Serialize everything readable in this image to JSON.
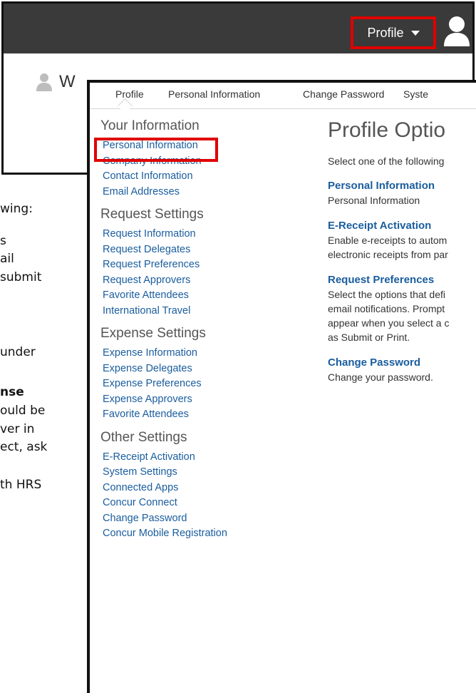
{
  "background_doc": {
    "lines": [
      "wing:",
      "s",
      "ail",
      "submit",
      "under",
      "nse",
      "ould be",
      "ver in",
      "ect, ask",
      "th HRS"
    ]
  },
  "header": {
    "profile_label": "Profile",
    "user_name_visible": "W"
  },
  "tabs": [
    "Profile",
    "Personal Information",
    "Change Password",
    "Syste"
  ],
  "sidebar": {
    "your_information": {
      "heading": "Your Information",
      "items": [
        "Personal Information",
        "Company Information",
        "Contact Information",
        "Email Addresses"
      ]
    },
    "request_settings": {
      "heading": "Request Settings",
      "items": [
        "Request Information",
        "Request Delegates",
        "Request Preferences",
        "Request Approvers",
        "Favorite Attendees",
        "International Travel"
      ]
    },
    "expense_settings": {
      "heading": "Expense Settings",
      "items": [
        "Expense Information",
        "Expense Delegates",
        "Expense Preferences",
        "Expense Approvers",
        "Favorite Attendees"
      ]
    },
    "other_settings": {
      "heading": "Other Settings",
      "items": [
        "E-Receipt Activation",
        "System Settings",
        "Connected Apps",
        "Concur Connect",
        "Change Password",
        "Concur Mobile Registration"
      ]
    }
  },
  "main": {
    "title": "Profile Optio",
    "intro": "Select one of the following",
    "options": [
      {
        "title": "Personal Information",
        "desc": [
          "Personal Information"
        ]
      },
      {
        "title": "E-Receipt Activation",
        "desc": [
          "Enable e-receipts to autom",
          "electronic receipts from par"
        ]
      },
      {
        "title": "Request Preferences",
        "desc": [
          "Select the options that defi",
          "email notifications. Prompt",
          "appear when you select a c",
          "as Submit or Print."
        ]
      },
      {
        "title": "Change Password",
        "desc": [
          "Change your password."
        ]
      }
    ]
  },
  "colors": {
    "link": "#1a5d9e",
    "highlight": "#e00000",
    "topbar": "#3a3a3a"
  }
}
